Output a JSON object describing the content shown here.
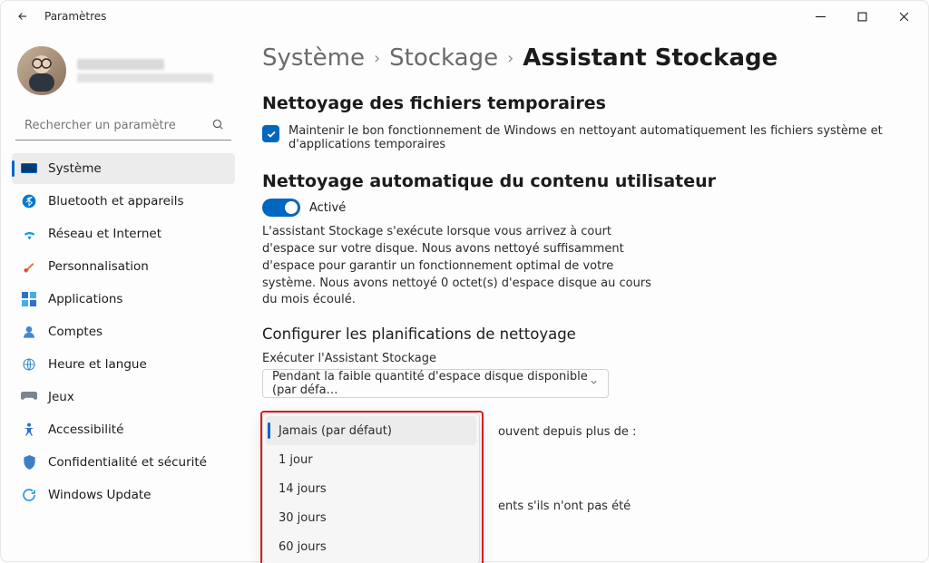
{
  "window": {
    "title": "Paramètres"
  },
  "sidebar": {
    "search_placeholder": "Rechercher un paramètre",
    "items": [
      {
        "label": "Système"
      },
      {
        "label": "Bluetooth et appareils"
      },
      {
        "label": "Réseau et Internet"
      },
      {
        "label": "Personnalisation"
      },
      {
        "label": "Applications"
      },
      {
        "label": "Comptes"
      },
      {
        "label": "Heure et langue"
      },
      {
        "label": "Jeux"
      },
      {
        "label": "Accessibilité"
      },
      {
        "label": "Confidentialité et sécurité"
      },
      {
        "label": "Windows Update"
      }
    ]
  },
  "breadcrumb": {
    "a": "Système",
    "b": "Stockage",
    "c": "Assistant Stockage"
  },
  "section1": {
    "title": "Nettoyage des fichiers temporaires",
    "check_label": "Maintenir le bon fonctionnement de Windows en nettoyant automatiquement les fichiers système et d'applications temporaires"
  },
  "section2": {
    "title": "Nettoyage automatique du contenu utilisateur",
    "toggle_label": "Activé",
    "desc": "L'assistant Stockage s'exécute lorsque vous arrivez à court d'espace sur votre disque. Nous avons nettoyé suffisamment d'espace pour garantir un fonctionnement optimal de votre système. Nous avons nettoyé 0 octet(s) d'espace disque au cours du mois écoulé.",
    "subhead": "Configurer les planifications de nettoyage",
    "field1_label": "Exécuter l'Assistant Stockage",
    "field1_value": "Pendant la faible quantité d'espace disque disponible (par défa…",
    "behind_text_1": "ouvent depuis plus de :",
    "behind_text_2": "ents s'ils n'ont pas été"
  },
  "dropdown": {
    "options": [
      "Jamais (par défaut)",
      "1 jour",
      "14 jours",
      "30 jours",
      "60 jours"
    ]
  }
}
